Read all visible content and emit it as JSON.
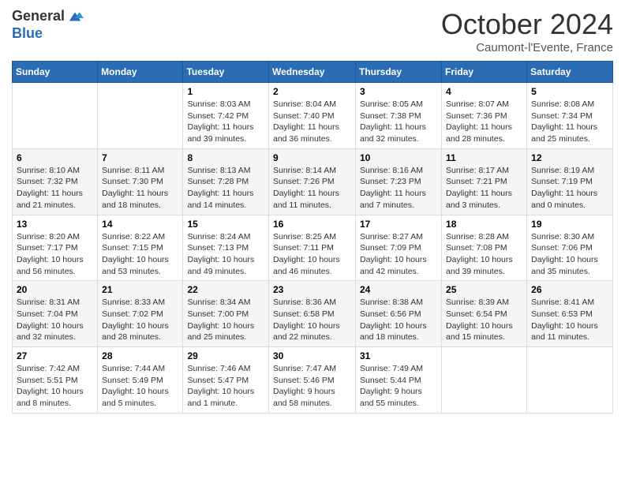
{
  "header": {
    "logo": {
      "general": "General",
      "blue": "Blue"
    },
    "title": "October 2024",
    "location": "Caumont-l'Evente, France"
  },
  "weekdays": [
    "Sunday",
    "Monday",
    "Tuesday",
    "Wednesday",
    "Thursday",
    "Friday",
    "Saturday"
  ],
  "weeks": [
    [
      {
        "day": "",
        "info": ""
      },
      {
        "day": "",
        "info": ""
      },
      {
        "day": "1",
        "info": "Sunrise: 8:03 AM\nSunset: 7:42 PM\nDaylight: 11 hours and 39 minutes."
      },
      {
        "day": "2",
        "info": "Sunrise: 8:04 AM\nSunset: 7:40 PM\nDaylight: 11 hours and 36 minutes."
      },
      {
        "day": "3",
        "info": "Sunrise: 8:05 AM\nSunset: 7:38 PM\nDaylight: 11 hours and 32 minutes."
      },
      {
        "day": "4",
        "info": "Sunrise: 8:07 AM\nSunset: 7:36 PM\nDaylight: 11 hours and 28 minutes."
      },
      {
        "day": "5",
        "info": "Sunrise: 8:08 AM\nSunset: 7:34 PM\nDaylight: 11 hours and 25 minutes."
      }
    ],
    [
      {
        "day": "6",
        "info": "Sunrise: 8:10 AM\nSunset: 7:32 PM\nDaylight: 11 hours and 21 minutes."
      },
      {
        "day": "7",
        "info": "Sunrise: 8:11 AM\nSunset: 7:30 PM\nDaylight: 11 hours and 18 minutes."
      },
      {
        "day": "8",
        "info": "Sunrise: 8:13 AM\nSunset: 7:28 PM\nDaylight: 11 hours and 14 minutes."
      },
      {
        "day": "9",
        "info": "Sunrise: 8:14 AM\nSunset: 7:26 PM\nDaylight: 11 hours and 11 minutes."
      },
      {
        "day": "10",
        "info": "Sunrise: 8:16 AM\nSunset: 7:23 PM\nDaylight: 11 hours and 7 minutes."
      },
      {
        "day": "11",
        "info": "Sunrise: 8:17 AM\nSunset: 7:21 PM\nDaylight: 11 hours and 3 minutes."
      },
      {
        "day": "12",
        "info": "Sunrise: 8:19 AM\nSunset: 7:19 PM\nDaylight: 11 hours and 0 minutes."
      }
    ],
    [
      {
        "day": "13",
        "info": "Sunrise: 8:20 AM\nSunset: 7:17 PM\nDaylight: 10 hours and 56 minutes."
      },
      {
        "day": "14",
        "info": "Sunrise: 8:22 AM\nSunset: 7:15 PM\nDaylight: 10 hours and 53 minutes."
      },
      {
        "day": "15",
        "info": "Sunrise: 8:24 AM\nSunset: 7:13 PM\nDaylight: 10 hours and 49 minutes."
      },
      {
        "day": "16",
        "info": "Sunrise: 8:25 AM\nSunset: 7:11 PM\nDaylight: 10 hours and 46 minutes."
      },
      {
        "day": "17",
        "info": "Sunrise: 8:27 AM\nSunset: 7:09 PM\nDaylight: 10 hours and 42 minutes."
      },
      {
        "day": "18",
        "info": "Sunrise: 8:28 AM\nSunset: 7:08 PM\nDaylight: 10 hours and 39 minutes."
      },
      {
        "day": "19",
        "info": "Sunrise: 8:30 AM\nSunset: 7:06 PM\nDaylight: 10 hours and 35 minutes."
      }
    ],
    [
      {
        "day": "20",
        "info": "Sunrise: 8:31 AM\nSunset: 7:04 PM\nDaylight: 10 hours and 32 minutes."
      },
      {
        "day": "21",
        "info": "Sunrise: 8:33 AM\nSunset: 7:02 PM\nDaylight: 10 hours and 28 minutes."
      },
      {
        "day": "22",
        "info": "Sunrise: 8:34 AM\nSunset: 7:00 PM\nDaylight: 10 hours and 25 minutes."
      },
      {
        "day": "23",
        "info": "Sunrise: 8:36 AM\nSunset: 6:58 PM\nDaylight: 10 hours and 22 minutes."
      },
      {
        "day": "24",
        "info": "Sunrise: 8:38 AM\nSunset: 6:56 PM\nDaylight: 10 hours and 18 minutes."
      },
      {
        "day": "25",
        "info": "Sunrise: 8:39 AM\nSunset: 6:54 PM\nDaylight: 10 hours and 15 minutes."
      },
      {
        "day": "26",
        "info": "Sunrise: 8:41 AM\nSunset: 6:53 PM\nDaylight: 10 hours and 11 minutes."
      }
    ],
    [
      {
        "day": "27",
        "info": "Sunrise: 7:42 AM\nSunset: 5:51 PM\nDaylight: 10 hours and 8 minutes."
      },
      {
        "day": "28",
        "info": "Sunrise: 7:44 AM\nSunset: 5:49 PM\nDaylight: 10 hours and 5 minutes."
      },
      {
        "day": "29",
        "info": "Sunrise: 7:46 AM\nSunset: 5:47 PM\nDaylight: 10 hours and 1 minute."
      },
      {
        "day": "30",
        "info": "Sunrise: 7:47 AM\nSunset: 5:46 PM\nDaylight: 9 hours and 58 minutes."
      },
      {
        "day": "31",
        "info": "Sunrise: 7:49 AM\nSunset: 5:44 PM\nDaylight: 9 hours and 55 minutes."
      },
      {
        "day": "",
        "info": ""
      },
      {
        "day": "",
        "info": ""
      }
    ]
  ]
}
